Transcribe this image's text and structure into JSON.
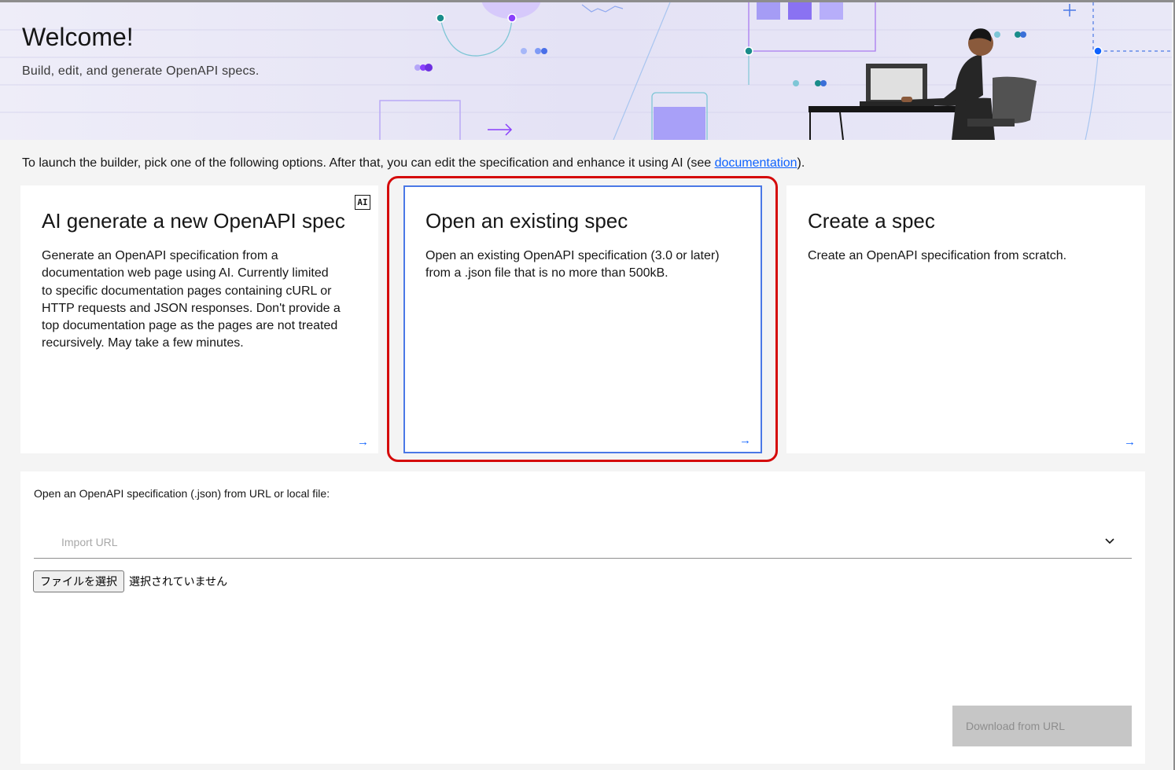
{
  "banner": {
    "title": "Welcome!",
    "subtitle": "Build, edit, and generate OpenAPI specs."
  },
  "intro": {
    "text_before": "To launch the builder, pick one of the following options. After that, you can edit the specification and enhance it using AI (see ",
    "link_label": "documentation",
    "text_after": ")."
  },
  "cards": [
    {
      "title": "AI generate a new OpenAPI spec",
      "badge": "AI",
      "description": "Generate an OpenAPI specification from a documentation web page using AI. Currently limited to specific documentation pages containing cURL or HTTP requests and JSON responses. Don't provide a top documentation page as the pages are not treated recursively. May take a few minutes.",
      "arrow": "→"
    },
    {
      "title": "Open an existing spec",
      "description": "Open an existing OpenAPI specification (3.0 or later) from a .json file that is no more than 500kB.",
      "arrow": "→",
      "selected": true
    },
    {
      "title": "Create a spec",
      "description": "Create an OpenAPI specification from scratch.",
      "arrow": "→"
    }
  ],
  "import": {
    "label": "Open an OpenAPI specification (.json) from URL or local file:",
    "url_placeholder": "Import URL",
    "url_value": "",
    "file_button_label": "ファイルを選択",
    "file_status": "選択されていません",
    "download_label": "Download from URL"
  },
  "colors": {
    "accent": "#0f62fe",
    "highlight": "#d50b0b",
    "selected_border": "#4a78e6"
  }
}
